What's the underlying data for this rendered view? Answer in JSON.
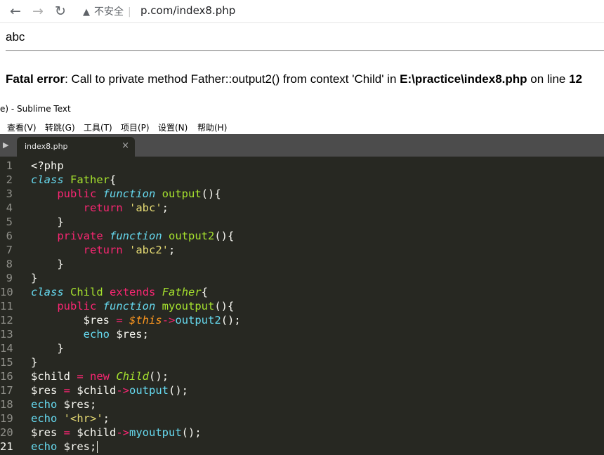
{
  "browser": {
    "security_label": "不安全",
    "url": "p.com/index8.php"
  },
  "page": {
    "output": "abc",
    "error": {
      "prefix": "Fatal error",
      "message": ": Call to private method Father::output2() from context 'Child' in ",
      "file": "E:\\practice\\index8.php",
      "on_line": " on line ",
      "line": "12"
    }
  },
  "editor": {
    "title": "e) - Sublime Text",
    "menu": [
      "查看(V)",
      "转跳(G)",
      "工具(T)",
      "项目(P)",
      "设置(N)",
      "帮助(H)"
    ],
    "tab": "index8.php",
    "active_line": 21,
    "lines": [
      {
        "n": "1",
        "t": [
          [
            "",
            "<?php"
          ]
        ]
      },
      {
        "n": "2",
        "t": [
          [
            "st",
            "class"
          ],
          [
            "",
            " "
          ],
          [
            "f",
            "Father"
          ],
          [
            "",
            "{"
          ]
        ]
      },
      {
        "n": "3",
        "t": [
          [
            "",
            "    "
          ],
          [
            "k",
            "public"
          ],
          [
            "",
            " "
          ],
          [
            "st",
            "function"
          ],
          [
            "",
            " "
          ],
          [
            "f",
            "output"
          ],
          [
            "",
            "(){"
          ]
        ]
      },
      {
        "n": "4",
        "t": [
          [
            "",
            "        "
          ],
          [
            "k",
            "return"
          ],
          [
            "",
            " "
          ],
          [
            "s",
            "'abc'"
          ],
          [
            "",
            ";"
          ]
        ]
      },
      {
        "n": "5",
        "t": [
          [
            "",
            "    }"
          ]
        ]
      },
      {
        "n": "6",
        "t": [
          [
            "",
            "    "
          ],
          [
            "k",
            "private"
          ],
          [
            "",
            " "
          ],
          [
            "st",
            "function"
          ],
          [
            "",
            " "
          ],
          [
            "f",
            "output2"
          ],
          [
            "",
            "(){"
          ]
        ]
      },
      {
        "n": "7",
        "t": [
          [
            "",
            "        "
          ],
          [
            "k",
            "return"
          ],
          [
            "",
            " "
          ],
          [
            "s",
            "'abc2'"
          ],
          [
            "",
            ";"
          ]
        ]
      },
      {
        "n": "8",
        "t": [
          [
            "",
            "    }"
          ]
        ]
      },
      {
        "n": "9",
        "t": [
          [
            "",
            "}"
          ]
        ]
      },
      {
        "n": "10",
        "t": [
          [
            "st",
            "class"
          ],
          [
            "",
            " "
          ],
          [
            "f",
            "Child"
          ],
          [
            "",
            " "
          ],
          [
            "k",
            "extends"
          ],
          [
            "",
            " "
          ],
          [
            "ci",
            "Father"
          ],
          [
            "",
            "{"
          ]
        ]
      },
      {
        "n": "11",
        "t": [
          [
            "",
            "    "
          ],
          [
            "k",
            "public"
          ],
          [
            "",
            " "
          ],
          [
            "st",
            "function"
          ],
          [
            "",
            " "
          ],
          [
            "f",
            "myoutput"
          ],
          [
            "",
            "(){"
          ]
        ]
      },
      {
        "n": "12",
        "t": [
          [
            "",
            "        $res "
          ],
          [
            "k",
            "="
          ],
          [
            "",
            " "
          ],
          [
            "var",
            "$this"
          ],
          [
            "k",
            "->"
          ],
          [
            "bl",
            "output2"
          ],
          [
            "",
            "();"
          ]
        ]
      },
      {
        "n": "13",
        "t": [
          [
            "",
            "        "
          ],
          [
            "bl",
            "echo"
          ],
          [
            "",
            " $res;"
          ]
        ]
      },
      {
        "n": "14",
        "t": [
          [
            "",
            "    }"
          ]
        ]
      },
      {
        "n": "15",
        "t": [
          [
            "",
            "}"
          ]
        ]
      },
      {
        "n": "16",
        "t": [
          [
            "",
            "$child "
          ],
          [
            "k",
            "="
          ],
          [
            "",
            " "
          ],
          [
            "k",
            "new"
          ],
          [
            "",
            " "
          ],
          [
            "ci",
            "Child"
          ],
          [
            "",
            "();"
          ]
        ]
      },
      {
        "n": "17",
        "t": [
          [
            "",
            "$res "
          ],
          [
            "k",
            "="
          ],
          [
            "",
            "",
            " "
          ],
          [
            "",
            " $child"
          ],
          [
            "k",
            "->"
          ],
          [
            "bl",
            "output"
          ],
          [
            "",
            "();"
          ]
        ]
      },
      {
        "n": "18",
        "t": [
          [
            "bl",
            "echo"
          ],
          [
            "",
            " $res;"
          ]
        ]
      },
      {
        "n": "19",
        "t": [
          [
            "bl",
            "echo"
          ],
          [
            "",
            " "
          ],
          [
            "s",
            "'<hr>'"
          ],
          [
            "",
            ";"
          ]
        ]
      },
      {
        "n": "20",
        "t": [
          [
            "",
            "$res "
          ],
          [
            "k",
            "="
          ],
          [
            "",
            " $child"
          ],
          [
            "k",
            "->"
          ],
          [
            "bl",
            "myoutput"
          ],
          [
            "",
            "();"
          ]
        ]
      },
      {
        "n": "21",
        "t": [
          [
            "bl",
            "echo"
          ],
          [
            "",
            " $res;"
          ]
        ]
      }
    ]
  }
}
